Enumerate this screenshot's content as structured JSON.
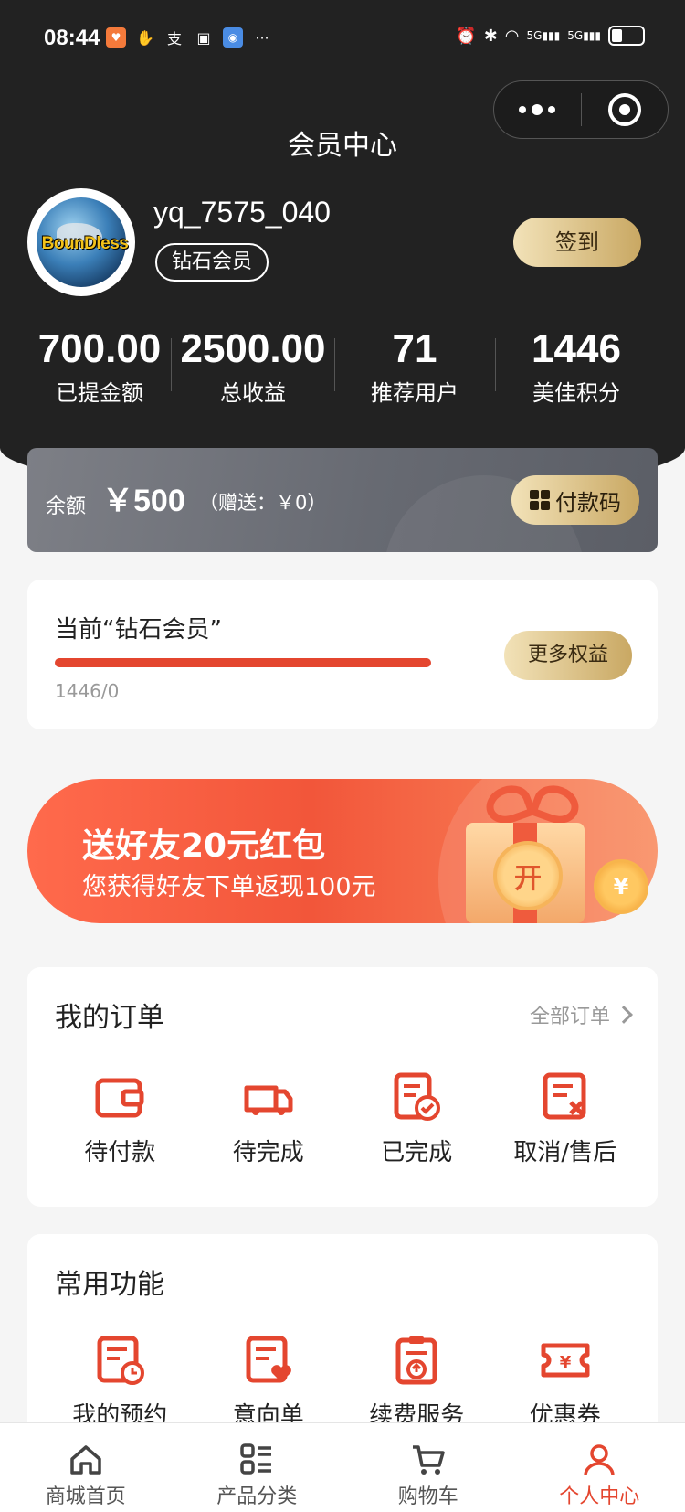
{
  "status_bar": {
    "time": "08:44",
    "more": "···",
    "network": "5G"
  },
  "page": {
    "title": "会员中心"
  },
  "user": {
    "name": "yq_7575_040",
    "level_badge": "钻石会员",
    "avatar_text": "BounDless"
  },
  "signin": {
    "label": "签到"
  },
  "stats": [
    {
      "value": "700.00",
      "label": "已提金额"
    },
    {
      "value": "2500.00",
      "label": "总收益"
    },
    {
      "value": "71",
      "label": "推荐用户"
    },
    {
      "value": "1446",
      "label": "美佳积分"
    }
  ],
  "balance": {
    "label": "余额",
    "amount": "￥500",
    "gift": "（赠送：￥0）",
    "paycode_label": "付款码"
  },
  "level": {
    "title": "当前“钻石会员”",
    "points": "1446/0",
    "progress": 1.0,
    "more_label": "更多权益"
  },
  "promo": {
    "title": "送好友20元红包",
    "subtitle": "您获得好友下单返现100元",
    "open_label": "开",
    "coin_label": "¥"
  },
  "orders": {
    "title": "我的订单",
    "all_label": "全部订单",
    "items": [
      {
        "label": "待付款",
        "icon": "wallet-icon"
      },
      {
        "label": "待完成",
        "icon": "truck-icon"
      },
      {
        "label": "已完成",
        "icon": "completed-document-icon"
      },
      {
        "label": "取消/售后",
        "icon": "cancel-document-icon"
      }
    ]
  },
  "functions": {
    "title": "常用功能",
    "items": [
      {
        "label": "我的预约",
        "icon": "appointment-icon"
      },
      {
        "label": "意向单",
        "icon": "wishlist-icon"
      },
      {
        "label": "续费服务",
        "icon": "renew-service-icon"
      },
      {
        "label": "优惠券",
        "icon": "coupon-icon"
      }
    ]
  },
  "tabbar": [
    {
      "label": "商城首页",
      "icon": "home-icon",
      "active": false
    },
    {
      "label": "产品分类",
      "icon": "category-icon",
      "active": false
    },
    {
      "label": "购物车",
      "icon": "cart-icon",
      "active": false
    },
    {
      "label": "个人中心",
      "icon": "user-icon",
      "active": true
    }
  ],
  "colors": {
    "accent": "#e4462f",
    "gold_start": "#f2e2b8",
    "gold_end": "#c9a863",
    "header_bg": "#222222"
  }
}
